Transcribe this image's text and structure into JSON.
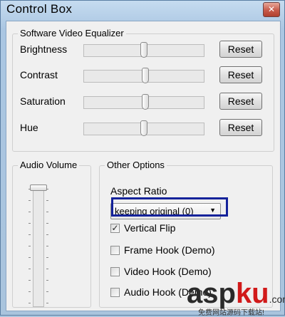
{
  "window": {
    "title": "Control Box"
  },
  "equalizer": {
    "title": "Software Video Equalizer",
    "rows": [
      {
        "label": "Brightness",
        "level": 0.5,
        "button": "Reset"
      },
      {
        "label": "Contrast",
        "level": 0.51,
        "button": "Reset"
      },
      {
        "label": "Saturation",
        "level": 0.51,
        "button": "Reset"
      },
      {
        "label": "Hue",
        "level": 0.5,
        "button": "Reset"
      }
    ]
  },
  "audio": {
    "title": "Audio Volume",
    "level": 1.0
  },
  "options": {
    "title": "Other Options",
    "aspect_label": "Aspect Ratio",
    "aspect_value": "keeping original (0)",
    "checkboxes": [
      {
        "label": "Vertical Flip",
        "checked": true
      },
      {
        "label": "Frame Hook (Demo)",
        "checked": false
      },
      {
        "label": "Video Hook (Demo)",
        "checked": false
      },
      {
        "label": "Audio Hook (Demo)",
        "checked": false
      }
    ]
  },
  "colors": {
    "highlight": "#14229a",
    "titlebar": "#c6dcf0",
    "watermark_accent": "#d11a1a"
  },
  "watermark": {
    "asp": "asp",
    "ku": "ku",
    "com": ".com",
    "sub": "免费网站源码下载站!"
  }
}
